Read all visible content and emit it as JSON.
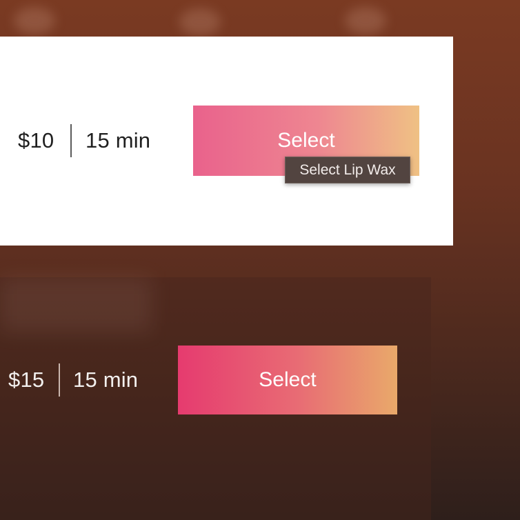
{
  "services": [
    {
      "price": "$10",
      "duration": "15 min",
      "button_label": "Select",
      "tooltip": "Select Lip Wax"
    },
    {
      "price": "$15",
      "duration": "15 min",
      "button_label": "Select"
    }
  ],
  "colors": {
    "background": "#6a3321",
    "card_active": "#ffffff",
    "button_gradient_start": "#e63b6f",
    "button_gradient_end": "#e9a96a",
    "tooltip_bg": "#524440"
  }
}
